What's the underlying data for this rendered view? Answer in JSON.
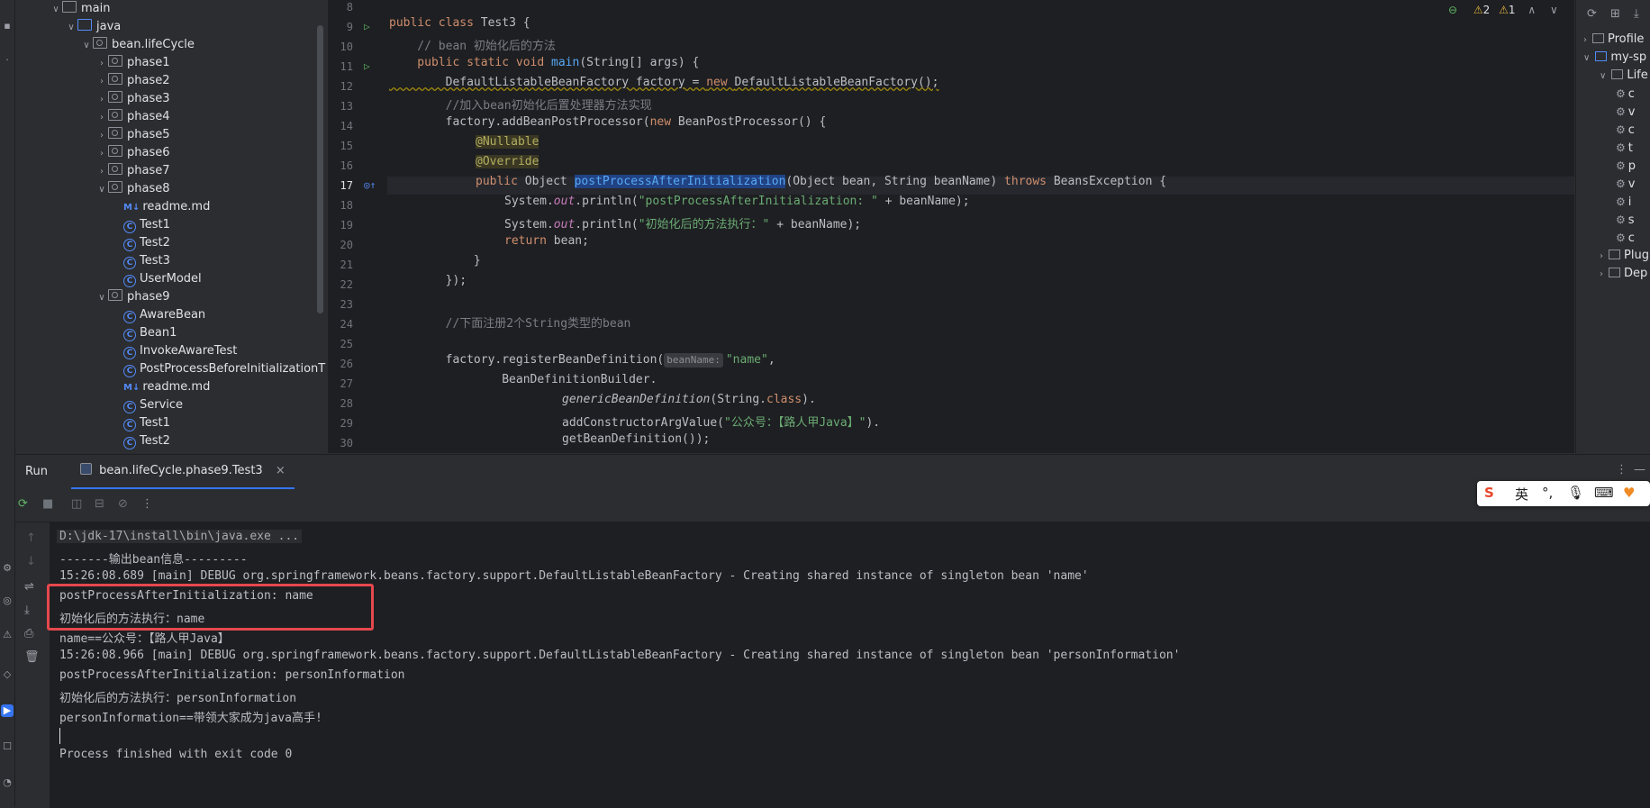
{
  "project_tree": {
    "items": [
      {
        "label": "main",
        "level": 1,
        "expanded": true,
        "kind": "folder"
      },
      {
        "label": "java",
        "level": 2,
        "expanded": true,
        "kind": "folder"
      },
      {
        "label": "bean.lifeCycle",
        "level": 3,
        "expanded": true,
        "kind": "package"
      },
      {
        "label": "phase1",
        "level": 4,
        "expanded": false,
        "kind": "package"
      },
      {
        "label": "phase2",
        "level": 4,
        "expanded": false,
        "kind": "package"
      },
      {
        "label": "phase3",
        "level": 4,
        "expanded": false,
        "kind": "package"
      },
      {
        "label": "phase4",
        "level": 4,
        "expanded": false,
        "kind": "package"
      },
      {
        "label": "phase5",
        "level": 4,
        "expanded": false,
        "kind": "package"
      },
      {
        "label": "phase6",
        "level": 4,
        "expanded": false,
        "kind": "package"
      },
      {
        "label": "phase7",
        "level": 4,
        "expanded": false,
        "kind": "package"
      },
      {
        "label": "phase8",
        "level": 4,
        "expanded": true,
        "kind": "package"
      },
      {
        "label": "readme.md",
        "level": 5,
        "kind": "markdown"
      },
      {
        "label": "Test1",
        "level": 5,
        "kind": "class"
      },
      {
        "label": "Test2",
        "level": 5,
        "kind": "class"
      },
      {
        "label": "Test3",
        "level": 5,
        "kind": "class"
      },
      {
        "label": "UserModel",
        "level": 5,
        "kind": "class"
      },
      {
        "label": "phase9",
        "level": 4,
        "expanded": true,
        "kind": "package"
      },
      {
        "label": "AwareBean",
        "level": 5,
        "kind": "class"
      },
      {
        "label": "Bean1",
        "level": 5,
        "kind": "class"
      },
      {
        "label": "InvokeAwareTest",
        "level": 5,
        "kind": "class"
      },
      {
        "label": "PostProcessBeforeInitializationT",
        "level": 5,
        "kind": "class"
      },
      {
        "label": "readme.md",
        "level": 5,
        "kind": "markdown"
      },
      {
        "label": "Service",
        "level": 5,
        "kind": "class"
      },
      {
        "label": "Test1",
        "level": 5,
        "kind": "class"
      },
      {
        "label": "Test2",
        "level": 5,
        "kind": "class"
      }
    ]
  },
  "editor": {
    "line_numbers": [
      "8",
      "9",
      "10",
      "11",
      "12",
      "13",
      "14",
      "15",
      "16",
      "17",
      "18",
      "19",
      "20",
      "21",
      "22",
      "23",
      "24",
      "25",
      "26",
      "27",
      "28",
      "29",
      "30"
    ],
    "current_line": "17",
    "inspections": {
      "warnings": "2",
      "weak_warnings": "1"
    },
    "code": {
      "l9_public": "public ",
      "l9_class": "class ",
      "l9_name": "Test3 {",
      "l10": "    // bean 初始化后的方法",
      "l11_a": "    public static void ",
      "l11_fn": "main",
      "l11_b": "(String[] args) {",
      "l12_a": "        DefaultListableBeanFactory factory = ",
      "l12_new": "new ",
      "l12_b": "DefaultListableBeanFactory();",
      "l13": "        //加入bean初始化后置处理器方法实现",
      "l14_a": "        factory.addBeanPostProcessor(",
      "l14_new": "new ",
      "l14_b": "BeanPostProcessor() {",
      "l15_ann": "@Nullable",
      "l16_ann": "@Override",
      "l17_pub": "public ",
      "l17_a": "Object ",
      "l17_fn": "postProcessAfterInitialization",
      "l17_b": "(Object bean, String beanName) ",
      "l17_throws": "throws ",
      "l17_c": "BeansException {",
      "l18_a": "System.",
      "l18_out": "out",
      "l18_b": ".println(",
      "l18_str": "\"postProcessAfterInitialization: \"",
      "l18_c": " + beanName);",
      "l19_a": "System.",
      "l19_out": "out",
      "l19_b": ".println(",
      "l19_str": "\"初始化后的方法执行：\"",
      "l19_c": " + beanName);",
      "l20_ret": "return ",
      "l20_a": "bean;",
      "l21": "            }",
      "l22": "        });",
      "l24": "        //下面注册2个String类型的bean",
      "l26_a": "        factory.registerBeanDefinition(",
      "l26_hint": "beanName:",
      "l26_str": "\"name\"",
      "l26_b": ",",
      "l27": "                BeanDefinitionBuilder.",
      "l28_fn": "genericBeanDefinition",
      "l28_a": "(String.",
      "l28_kw": "class",
      "l28_b": ").",
      "l29_a": "addConstructorArgValue(",
      "l29_str": "\"公众号：【路人甲Java】\"",
      "l29_b": ").",
      "l30": "getBeanDefinition());"
    }
  },
  "right_panel": {
    "items": [
      {
        "label": "Profile",
        "level": 0,
        "kind": "folder"
      },
      {
        "label": "my-sp",
        "level": 0,
        "kind": "maven"
      },
      {
        "label": "Life",
        "level": 1,
        "kind": "folder"
      },
      {
        "label": "c",
        "level": 2,
        "kind": "gear"
      },
      {
        "label": "v",
        "level": 2,
        "kind": "gear"
      },
      {
        "label": "c",
        "level": 2,
        "kind": "gear"
      },
      {
        "label": "t",
        "level": 2,
        "kind": "gear"
      },
      {
        "label": "p",
        "level": 2,
        "kind": "gear"
      },
      {
        "label": "v",
        "level": 2,
        "kind": "gear"
      },
      {
        "label": "i",
        "level": 2,
        "kind": "gear"
      },
      {
        "label": "s",
        "level": 2,
        "kind": "gear"
      },
      {
        "label": "c",
        "level": 2,
        "kind": "gear"
      },
      {
        "label": "Plug",
        "level": 1,
        "kind": "folder"
      },
      {
        "label": "Dep",
        "level": 1,
        "kind": "folder"
      }
    ]
  },
  "run": {
    "run_label": "Run",
    "tab_label": "bean.lifeCycle.phase9.Test3",
    "console_lines": [
      "D:\\jdk-17\\install\\bin\\java.exe ...",
      "-------输出bean信息---------",
      "15:26:08.689 [main] DEBUG org.springframework.beans.factory.support.DefaultListableBeanFactory - Creating shared instance of singleton bean 'name'",
      "postProcessAfterInitialization: name",
      "初始化后的方法执行：name",
      "name==公众号：【路人甲Java】",
      "15:26:08.966 [main] DEBUG org.springframework.beans.factory.support.DefaultListableBeanFactory - Creating shared instance of singleton bean 'personInformation'",
      "postProcessAfterInitialization: personInformation",
      "初始化后的方法执行：personInformation",
      "personInformation==带领大家成为java高手!",
      "",
      "Process finished with exit code 0"
    ]
  },
  "ime": {
    "mode": "英"
  },
  "colors": {
    "highlight_box": "#e5484d",
    "keyword": "#cf8e6d",
    "string": "#6aab73",
    "annotation": "#b3ae60",
    "function": "#56a8f5"
  }
}
